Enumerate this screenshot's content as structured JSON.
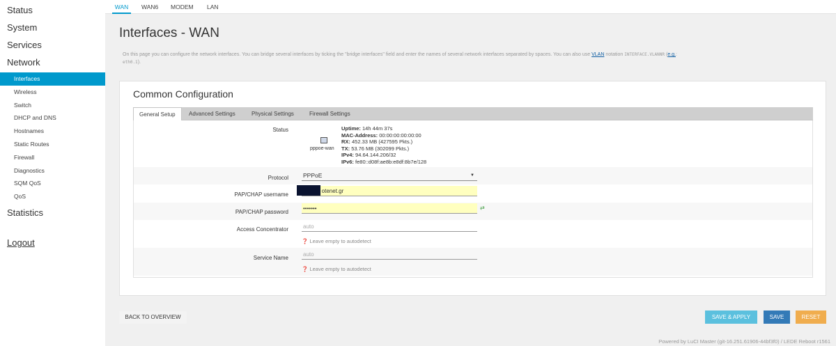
{
  "sidebar": {
    "status": "Status",
    "system": "System",
    "services": "Services",
    "network": "Network",
    "network_items": [
      "Interfaces",
      "Wireless",
      "Switch",
      "DHCP and DNS",
      "Hostnames",
      "Static Routes",
      "Firewall",
      "Diagnostics",
      "SQM QoS",
      "QoS"
    ],
    "statistics": "Statistics",
    "logout": "Logout"
  },
  "top_tabs": [
    "WAN",
    "WAN6",
    "MODEM",
    "LAN"
  ],
  "page": {
    "title": "Interfaces - WAN",
    "description_1": "On this page you can configure the network interfaces. You can bridge several interfaces by ticking the \"bridge interfaces\" field and enter the names of several network interfaces separated by spaces. You can also use ",
    "description_vlan": "VLAN",
    "description_2": " notation ",
    "description_code": "INTERFACE.VLANNR",
    "description_3": " (",
    "description_eg": "e.g.",
    "description_4": ":",
    "description_example": "eth0.1",
    "description_5": ")."
  },
  "section": {
    "title": "Common Configuration",
    "tabs": [
      "General Setup",
      "Advanced Settings",
      "Physical Settings",
      "Firewall Settings"
    ]
  },
  "status": {
    "label": "Status",
    "interface": "pppoe-wan",
    "uptime_label": "Uptime:",
    "uptime": "14h 44m 37s",
    "mac_label": "MAC-Address:",
    "mac": "00:00:00:00:00:00",
    "rx_label": "RX:",
    "rx": "452.33 MB (427595 Pkts.)",
    "tx_label": "TX:",
    "tx": "53.76 MB (302099 Pkts.)",
    "ipv4_label": "IPv4:",
    "ipv4": "94.64.144.206/32",
    "ipv6_label": "IPv6:",
    "ipv6": "fe80::d08f:ae8b:e8df:8b7e/128"
  },
  "form": {
    "protocol_label": "Protocol",
    "protocol_value": "PPPoE",
    "username_label": "PAP/CHAP username",
    "username_value": "            otenet.gr",
    "password_label": "PAP/CHAP password",
    "password_value": "•••••••",
    "ac_label": "Access Concentrator",
    "ac_placeholder": "auto",
    "ac_hint": "Leave empty to autodetect",
    "service_label": "Service Name",
    "service_placeholder": "auto",
    "service_hint": "Leave empty to autodetect"
  },
  "footer": {
    "back": "BACK TO OVERVIEW",
    "save_apply": "SAVE & APPLY",
    "save": "SAVE",
    "reset": "RESET",
    "powered_by": "Powered by LuCI Master (git-16.251.61906-44bf3f0) / LEDE Reboot r1561"
  }
}
